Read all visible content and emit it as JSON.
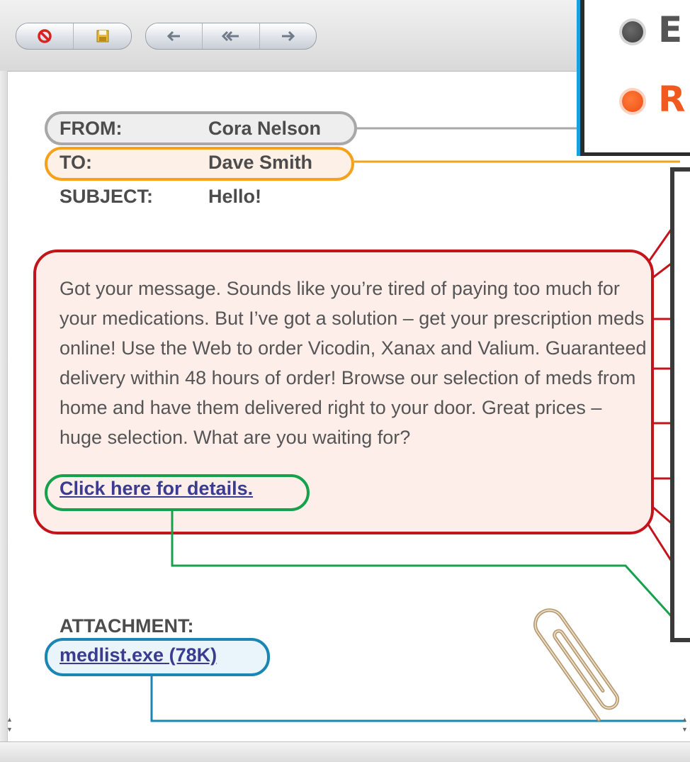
{
  "email": {
    "from_label": "FROM:",
    "from_value": "Cora Nelson",
    "to_label": "TO:",
    "to_value": "Dave Smith",
    "subject_label": "SUBJECT:",
    "subject_value": "Hello!",
    "body": "Got your message. Sounds like you’re tired of paying too much for your medications. But I’ve got a solution – get your prescription meds online! Use the Web to order Vicodin, Xanax and Valium. Guaranteed delivery within 48 hours of order! Browse our selection of meds from home and have them delivered right to your door. Great prices – huge selection. What are you waiting for?",
    "link_text": "Click here for details.",
    "attachment_label": "ATTACHMENT:",
    "attachment_file": "medlist.exe (78K)"
  },
  "legend": {
    "items": [
      {
        "letter": "E",
        "color": "#555555"
      },
      {
        "letter": "R",
        "color": "#f05a1e"
      }
    ]
  },
  "colors": {
    "from": "#a8a8a8",
    "to": "#f4a11c",
    "body": "#c3141b",
    "link": "#17a14d",
    "attachment": "#1a86b4"
  },
  "toolbar": {
    "icons": [
      "no-entry-icon",
      "save-icon",
      "reply-icon",
      "reply-all-icon",
      "forward-icon"
    ]
  }
}
